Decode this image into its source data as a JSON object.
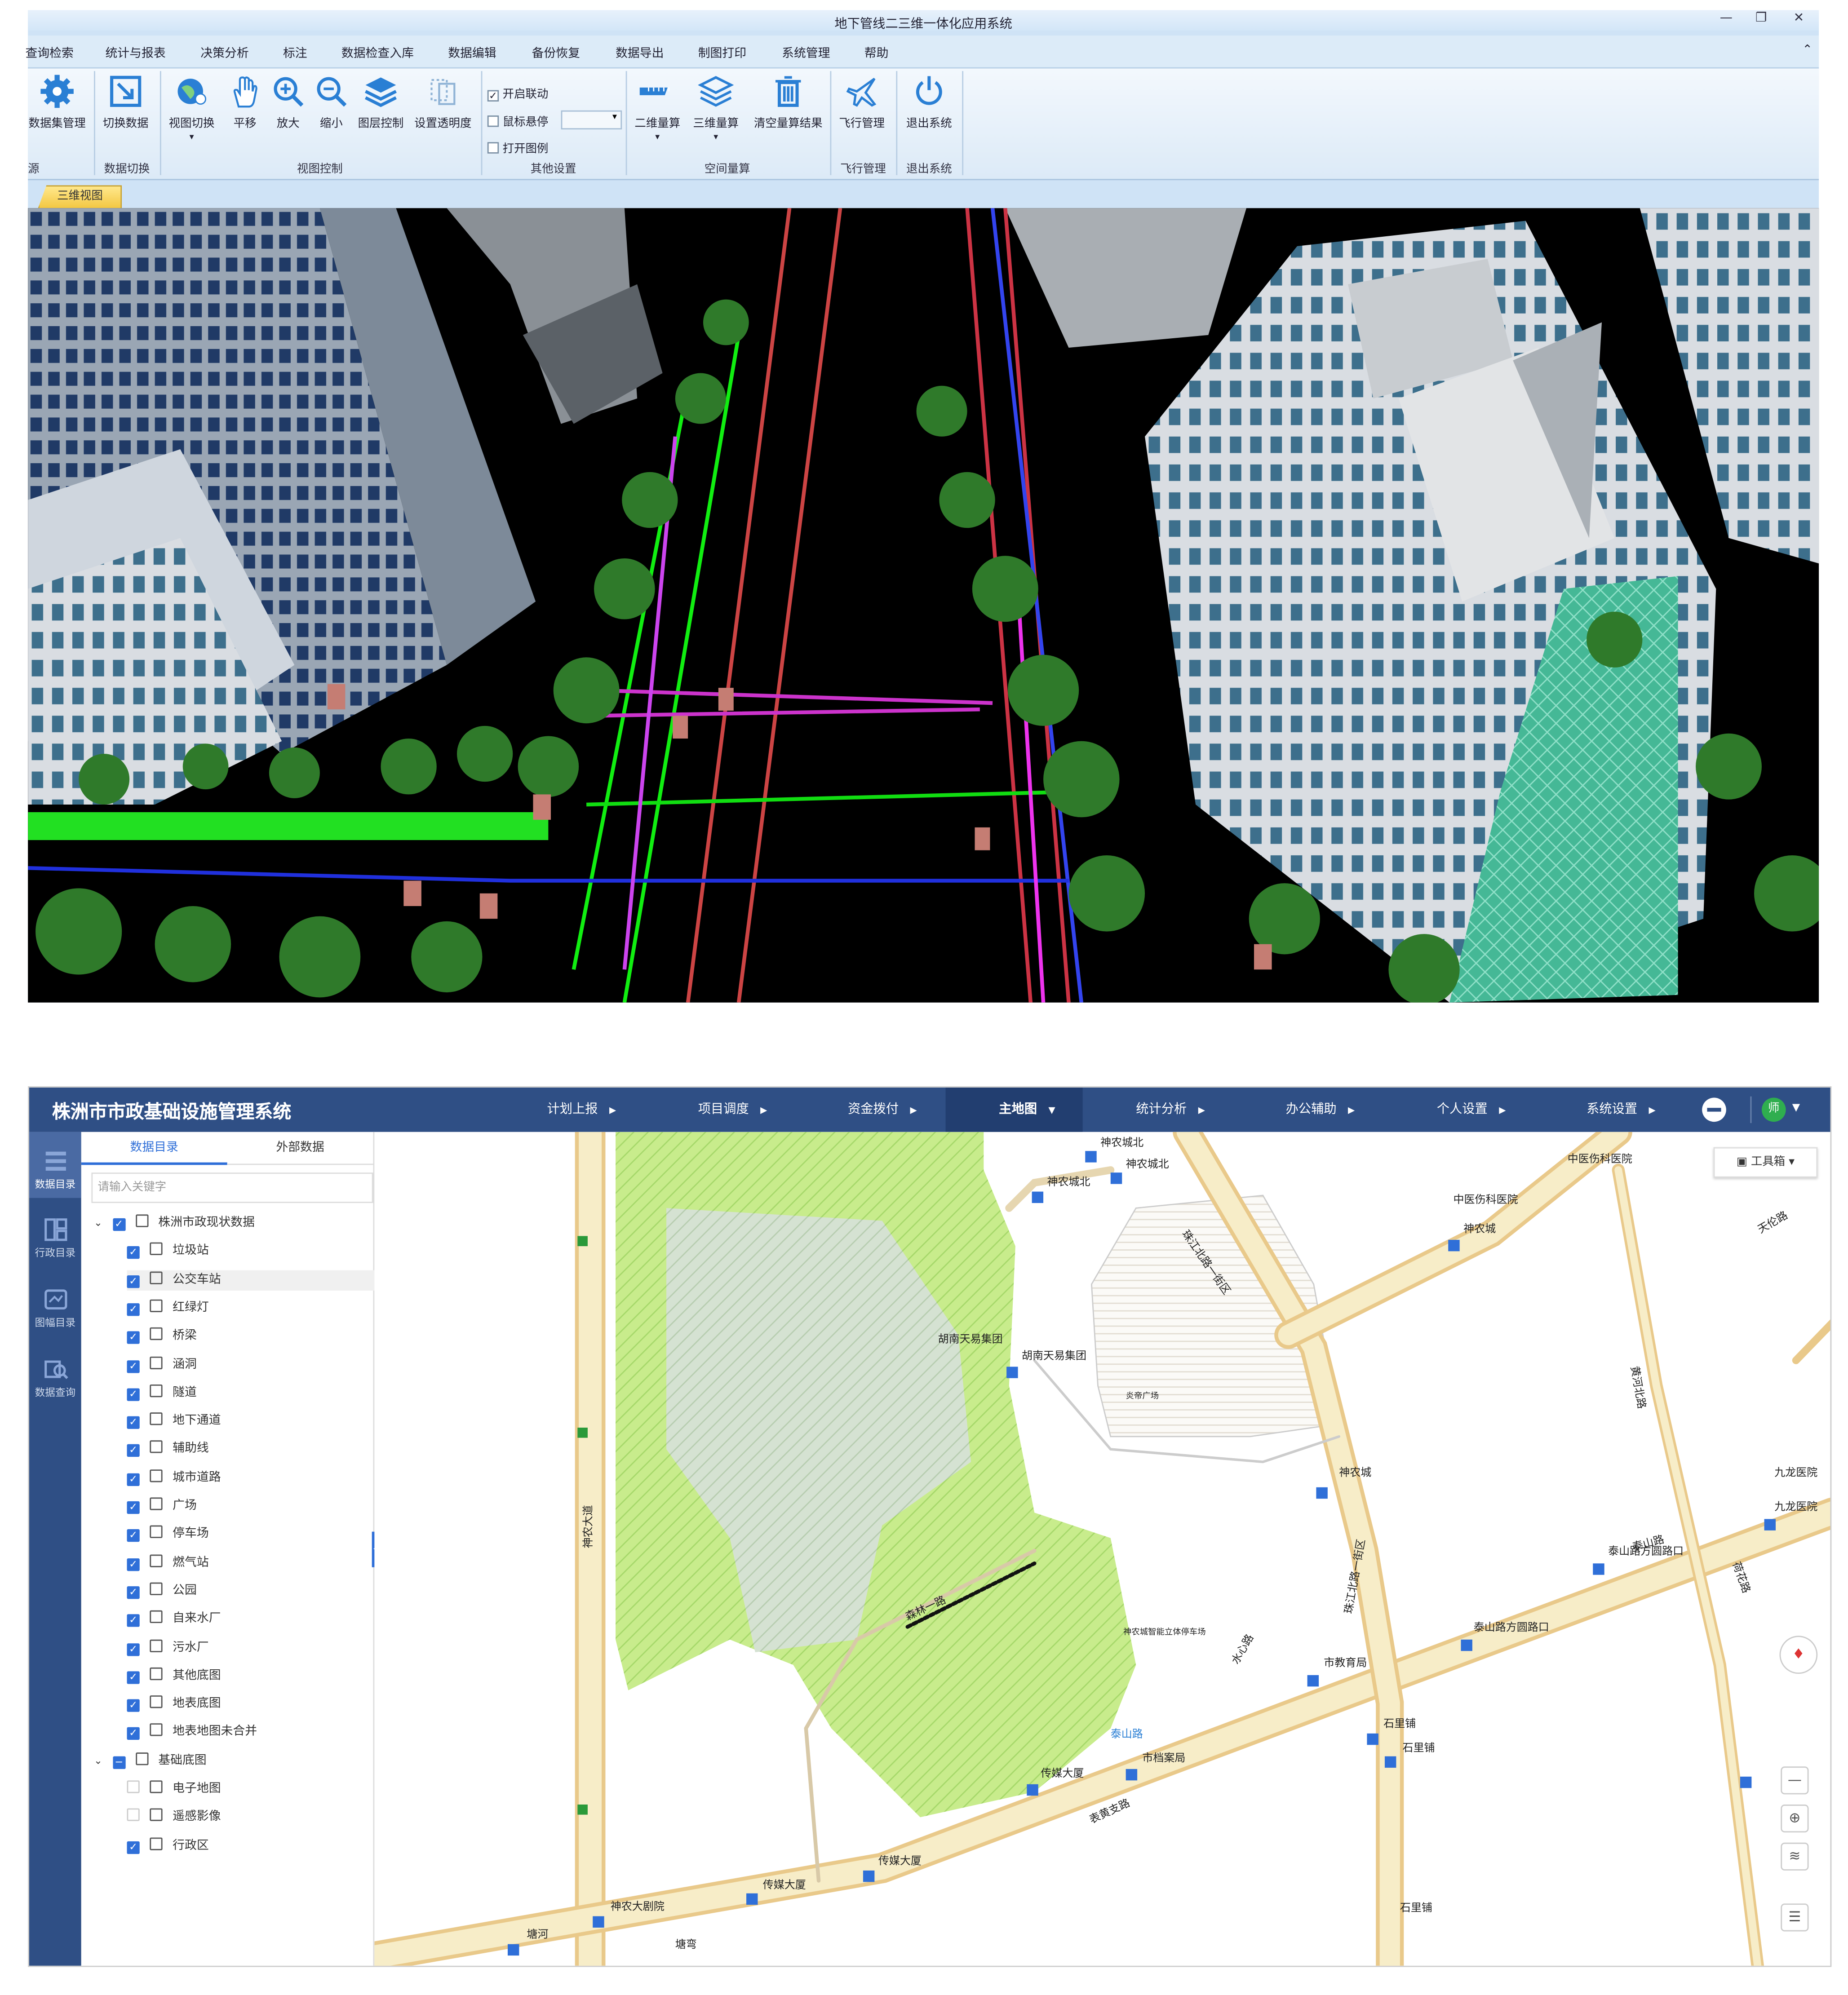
{
  "top_app": {
    "title": "地下管线二三维一体化应用系统",
    "window_buttons": [
      "—",
      "❐",
      "✕"
    ],
    "menu": [
      "查询检索",
      "统计与报表",
      "决策分析",
      "标注",
      "数据检查入库",
      "数据编辑",
      "备份恢复",
      "数据导出",
      "制图打印",
      "系统管理",
      "帮助"
    ],
    "ribbon_buttons": [
      "数据集管理",
      "切换数据",
      "视图切换",
      "平移",
      "放大",
      "缩小",
      "图层控制",
      "设置透明度",
      "二维量算",
      "三维量算",
      "清空量算结果",
      "飞行管理",
      "退出系统"
    ],
    "ribbon_checks": [
      {
        "label": "开启联动",
        "checked": true
      },
      {
        "label": "鼠标悬停",
        "checked": false
      },
      {
        "label": "打开图例",
        "checked": false
      }
    ],
    "ribbon_groups": [
      "源",
      "数据切换",
      "视图控制",
      "其他设置",
      "空间量算",
      "飞行管理",
      "退出系统"
    ],
    "view_tab": "三维视图"
  },
  "bottom_app": {
    "system_name": "株洲市市政基础设施管理系统",
    "nav": [
      "计划上报",
      "项目调度",
      "资金拨付",
      "主地图",
      "统计分析",
      "办公辅助",
      "个人设置",
      "系统设置"
    ],
    "nav_active": "主地图",
    "user_badge": "师",
    "left_bar": [
      "数据目录",
      "行政目录",
      "图幅目录",
      "数据查询"
    ],
    "panel_tabs": [
      "数据目录",
      "外部数据"
    ],
    "search_placeholder": "请输入关键字",
    "tree": [
      {
        "label": "株洲市政现状数据",
        "level": 0,
        "state": "on"
      },
      {
        "label": "垃圾站",
        "level": 1,
        "state": "on"
      },
      {
        "label": "公交车站",
        "level": 1,
        "state": "on"
      },
      {
        "label": "红绿灯",
        "level": 1,
        "state": "on"
      },
      {
        "label": "桥梁",
        "level": 1,
        "state": "on"
      },
      {
        "label": "涵洞",
        "level": 1,
        "state": "on"
      },
      {
        "label": "隧道",
        "level": 1,
        "state": "on"
      },
      {
        "label": "地下通道",
        "level": 1,
        "state": "on"
      },
      {
        "label": "辅助线",
        "level": 1,
        "state": "on"
      },
      {
        "label": "城市道路",
        "level": 1,
        "state": "on"
      },
      {
        "label": "广场",
        "level": 1,
        "state": "on"
      },
      {
        "label": "停车场",
        "level": 1,
        "state": "on"
      },
      {
        "label": "燃气站",
        "level": 1,
        "state": "on"
      },
      {
        "label": "公园",
        "level": 1,
        "state": "on"
      },
      {
        "label": "自来水厂",
        "level": 1,
        "state": "on"
      },
      {
        "label": "污水厂",
        "level": 1,
        "state": "on"
      },
      {
        "label": "其他底图",
        "level": 1,
        "state": "on"
      },
      {
        "label": "地表底图",
        "level": 1,
        "state": "on"
      },
      {
        "label": "地表地图未合并",
        "level": 1,
        "state": "on"
      },
      {
        "label": "基础底图",
        "level": 0,
        "state": "part"
      },
      {
        "label": "电子地图",
        "level": 1,
        "state": "off"
      },
      {
        "label": "遥感影像",
        "level": 1,
        "state": "off"
      },
      {
        "label": "行政区",
        "level": 1,
        "state": "on"
      }
    ],
    "toolbox": "工具箱",
    "map_labels": [
      "神农城北",
      "神农城北",
      "神农城北",
      "中医伤科医院",
      "中医伤科医院",
      "神农城",
      "天伦路",
      "珠江北路一街区",
      "胡南天易集团",
      "胡南天易集团",
      "神农城",
      "九龙医院",
      "九龙医院",
      "泰山路方圆路口",
      "泰山路方圆路口",
      "市教育局",
      "石里铺",
      "石里铺",
      "石里铺",
      "市档案局",
      "传媒大厦",
      "传媒大厦",
      "传媒大厦",
      "神农大剧院",
      "塘河",
      "塘弯",
      "神农大道",
      "泰山路",
      "黄河北路",
      "珠江北路一街区",
      "神农城",
      "炎帝广场",
      "神农城智能立体停车场",
      "水心路",
      "森林一路",
      "表黄支路",
      "荷花路",
      "泰山路"
    ]
  }
}
